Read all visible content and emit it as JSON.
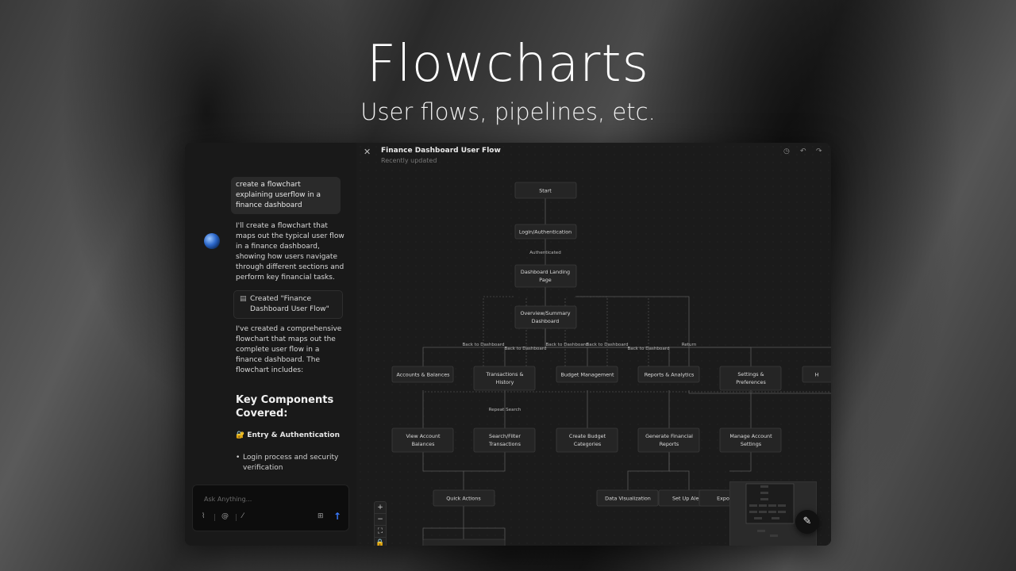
{
  "hero": {
    "title": "Flowcharts",
    "subtitle": "User flows, pipelines, etc."
  },
  "chat": {
    "user_message": "create a flowchart explaining userflow in a finance dashboard",
    "assistant_intro": "I'll create a flowchart that maps out the typical user flow in a finance dashboard, showing how users navigate through different sections and perform key financial tasks.",
    "artifact_label": "Created \"Finance Dashboard User Flow\"",
    "assistant_summary": "I've created a comprehensive flowchart that maps out the complete user flow in a finance dashboard. The flowchart includes:",
    "key_heading": "Key Components Covered:",
    "section_title": "🔐 Entry & Authentication",
    "bullet": "Login process and security verification",
    "composer_placeholder": "Ask Anything...",
    "icons": {
      "attach": "paperclip-icon",
      "mention": "at-icon",
      "pen": "pen-icon",
      "grid": "grid-icon",
      "send": "arrow-up-icon",
      "doc": "document-icon"
    },
    "accent_color": "#3a7bff"
  },
  "canvas": {
    "title": "Finance Dashboard User Flow",
    "subtitle": "Recently updated",
    "zoom_controls": [
      "+",
      "−",
      "⛶",
      "🔒"
    ],
    "header_icons": [
      "clock-icon",
      "undo-icon",
      "redo-icon"
    ],
    "nodes": {
      "start": "Start",
      "login": "Login/Authentication",
      "landing": "Dashboard Landing Page",
      "overview": "Overview/Summary Dashboard",
      "accounts": "Accounts & Balances",
      "transactions": "Transactions & History",
      "budget": "Budget Management",
      "reports": "Reports & Analytics",
      "settings": "Settings & Preferences",
      "help": "H",
      "view_accounts": "View Account Balances",
      "search": "Search/Filter Transactions",
      "create_budget": "Create Budget Categories",
      "gen_reports": "Generate Financial Reports",
      "manage_settings": "Manage Account Settings",
      "quick_actions": "Quick Actions",
      "data_viz": "Data Visualization",
      "alerts": "Set Up Aler",
      "export": "Expo"
    },
    "edge_labels": {
      "authenticated": "Authenticated",
      "back1": "Back to Dashboard",
      "back2": "Back to Dashboard",
      "back3": "Back to Dashboard",
      "back4": "Back to Dashboard",
      "back5": "Back to Dashboard",
      "return": "Return",
      "repeat": "Repeat Search"
    }
  }
}
